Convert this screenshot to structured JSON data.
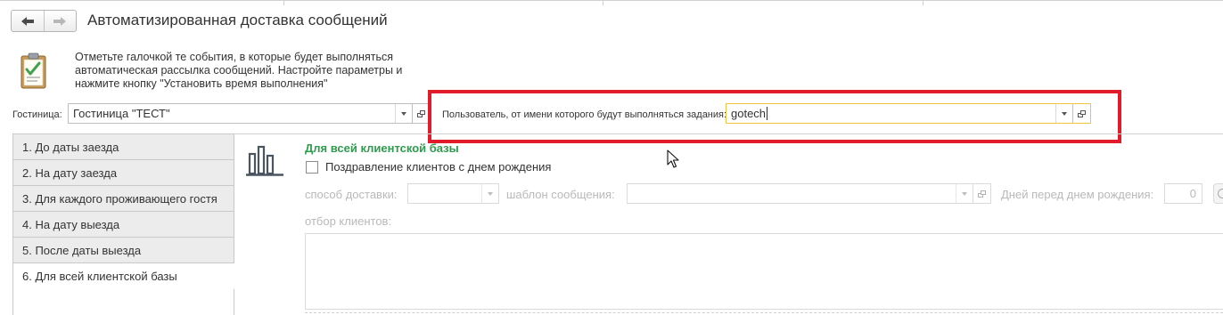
{
  "window": {
    "title": "Автоматизированная доставка сообщений"
  },
  "navigation": {
    "back_icon": "arrow-left-icon",
    "forward_icon": "arrow-right-icon"
  },
  "hint": {
    "icon": "clipboard-checklist-icon",
    "lines": [
      "Отметьте галочкой те события, в которые будет выполняться",
      "автоматическая рассылка сообщений. Настройте параметры и",
      "нажмите кнопку \"Установить время выполнения\""
    ]
  },
  "hotel": {
    "label": "Гостиница:",
    "value": "Гостиница \"ТЕСТ\""
  },
  "user": {
    "label": "Пользователь, от имени которого будут выполняться задания:",
    "value": "gotech"
  },
  "tabs": [
    {
      "label": "1. До даты заезда",
      "active": false
    },
    {
      "label": "2. На дату заезда",
      "active": false
    },
    {
      "label": "3. Для каждого проживающего гостя",
      "active": false
    },
    {
      "label": "4. На дату выезда",
      "active": false
    },
    {
      "label": "5. После даты выезда",
      "active": false
    },
    {
      "label": "6. Для всей клиентской базы",
      "active": true
    }
  ],
  "section": {
    "icon": "bar-chart-icon",
    "title": "Для всей клиентской базы",
    "checkbox_label": "Поздравление клиентов с днем рождения",
    "checkbox_checked": false,
    "delivery_label": "способ доставки:",
    "delivery_value": "",
    "template_label": "шаблон сообщения:",
    "template_value": "",
    "days_label": "Дней перед днем рождения:",
    "days_value": "0",
    "filter_label": "отбор клиентов:"
  },
  "colors": {
    "highlight": "#e21b2a",
    "section_title": "#2e9c4e",
    "focused_field_border": "#f0c341"
  }
}
